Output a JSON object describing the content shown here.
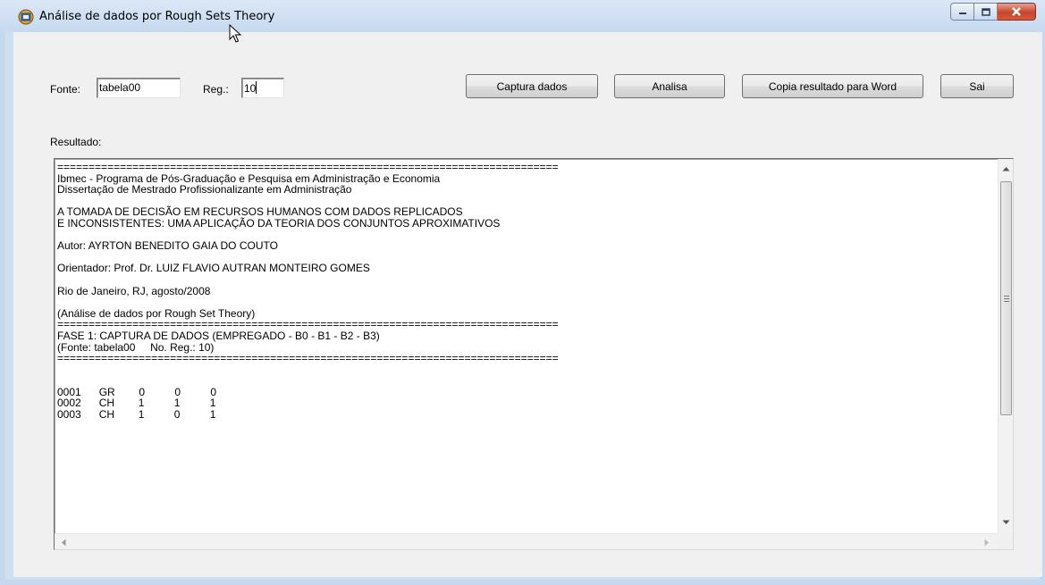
{
  "window": {
    "title": "Análise de dados por Rough Sets Theory",
    "icon": "app-icon"
  },
  "form": {
    "fonte_label": "Fonte:",
    "fonte_value": "tabela00",
    "reg_label": "Reg.:",
    "reg_value": "10",
    "resultado_label": "Resultado:"
  },
  "buttons": {
    "captura": "Captura dados",
    "analisa": "Analisa",
    "copia": "Copia resultado para Word",
    "sai": "Sai"
  },
  "result_lines": [
    "================================================================================",
    "Ibmec - Programa de Pós-Graduação e Pesquisa em Administração e Economia",
    "Dissertação de Mestrado Profissionalizante em Administração",
    "",
    "A TOMADA DE DECISÃO EM RECURSOS HUMANOS COM DADOS REPLICADOS",
    "E INCONSISTENTES: UMA APLICAÇÃO DA TEORIA DOS CONJUNTOS APROXIMATIVOS",
    "",
    "Autor: AYRTON BENEDITO GAIA DO COUTO",
    "",
    "Orientador: Prof. Dr. LUIZ FLAVIO AUTRAN MONTEIRO GOMES",
    "",
    "Rio de Janeiro, RJ, agosto/2008",
    "",
    "(Análise de dados por Rough Set Theory)",
    "================================================================================",
    "FASE 1: CAPTURA DE DADOS (EMPREGADO - B0 - B1 - B2 - B3)",
    "(Fonte: tabela00     No. Reg.: 10)",
    "================================================================================",
    "",
    "",
    "0001      GR        0          0          0",
    "0002      CH        1          1          1",
    "0003      CH        1          0          1"
  ],
  "colors": {
    "frame": "#c5d8ee",
    "client": "#f0f0f0",
    "close_button": "#c7442d"
  }
}
